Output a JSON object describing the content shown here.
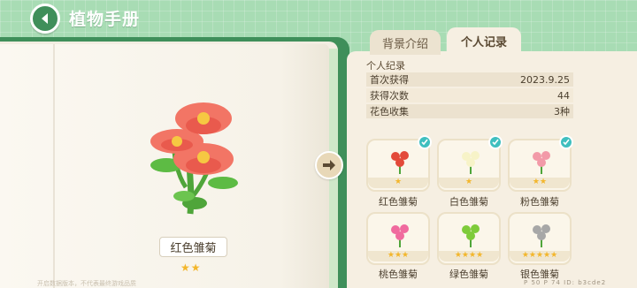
{
  "header": {
    "title": "植物手册"
  },
  "tabs": [
    {
      "label": "背景介绍"
    },
    {
      "label": "个人记录"
    }
  ],
  "left_page": {
    "flower_name": "红色雏菊",
    "stars": "★★",
    "footnote": "开启数据版本，不代表最终游戏品质"
  },
  "record": {
    "header": "个人纪录",
    "rows": [
      {
        "label": "首次获得",
        "value": "2023.9.25"
      },
      {
        "label": "获得次数",
        "value": "44"
      },
      {
        "label": "花色收集",
        "value": "3种"
      }
    ]
  },
  "flowers": [
    {
      "name": "红色雏菊",
      "stars": "★",
      "collected": true,
      "color": "#e34a3a"
    },
    {
      "name": "白色雏菊",
      "stars": "★",
      "collected": true,
      "color": "#f7f3c8"
    },
    {
      "name": "粉色雏菊",
      "stars": "★★",
      "collected": true,
      "color": "#f29aa8"
    },
    {
      "name": "桃色雏菊",
      "stars": "★★★",
      "collected": false,
      "color": "#f06a9e"
    },
    {
      "name": "绿色雏菊",
      "stars": "★★★★",
      "collected": false,
      "color": "#7ecb3a"
    },
    {
      "name": "银色雏菊",
      "stars": "★★★★★",
      "collected": false,
      "color": "#a7a7a7"
    }
  ],
  "bottom_info": "P 50  P 74  ID: b3cde2",
  "colors": {
    "accent": "#3f8f5a",
    "check": "#3fbfbf",
    "star": "#f3b62b"
  }
}
